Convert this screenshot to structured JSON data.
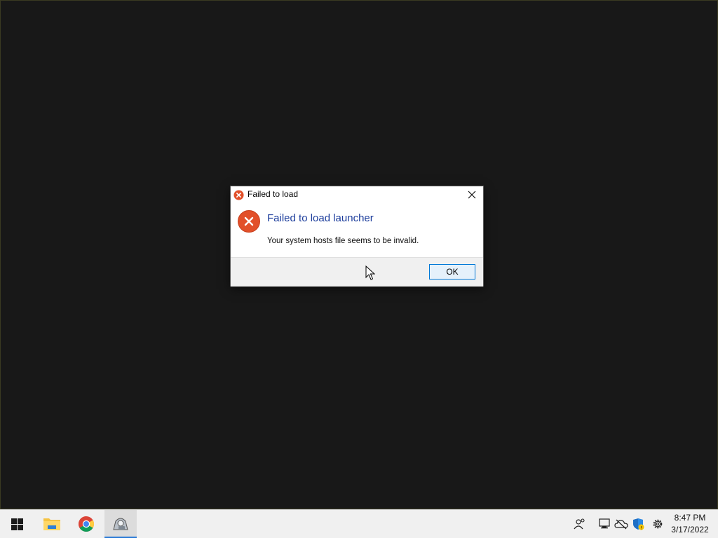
{
  "dialog": {
    "title": "Failed to load",
    "main_instruction": "Failed to load launcher",
    "content": "Your system hosts file seems to be invalid.",
    "ok_label": "OK"
  },
  "taskbar": {
    "apps": [
      {
        "icon": "windows-start-icon"
      },
      {
        "icon": "file-explorer-icon"
      },
      {
        "icon": "chrome-icon"
      },
      {
        "icon": "launcher-app-icon",
        "active": true
      }
    ],
    "tray": [
      "people-icon",
      "network-icon",
      "onedrive-offline-icon",
      "defender-shield-icon",
      "settings-gear-icon"
    ],
    "clock": {
      "time": "8:47 PM",
      "date": "3/17/2022"
    }
  },
  "colors": {
    "error_red": "#e2502a",
    "link_blue": "#1c3d9c",
    "accent": "#0078d7"
  }
}
